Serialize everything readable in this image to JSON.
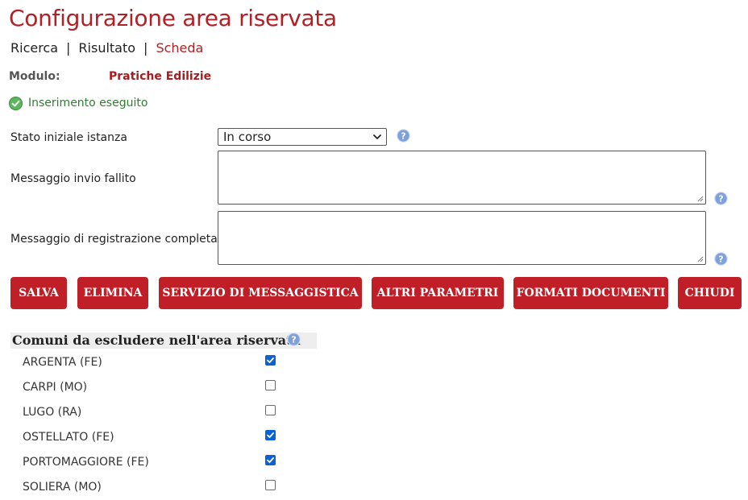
{
  "header": {
    "title": "Configurazione area riservata"
  },
  "breadcrumb": {
    "items": [
      "Ricerca",
      "Risultato",
      "Scheda"
    ],
    "separator": "|"
  },
  "module": {
    "label": "Modulo:",
    "value": "Pratiche Edilizie"
  },
  "status": {
    "message": "Inserimento eseguito",
    "icon": "check-circle-icon"
  },
  "form": {
    "stato_label": "Stato iniziale istanza",
    "stato_value": "In corso",
    "messaggio_fallito_label": "Messaggio invio fallito",
    "messaggio_fallito_value": "",
    "messaggio_registrazione_label": "Messaggio di registrazione completata",
    "messaggio_registrazione_value": ""
  },
  "buttons": [
    "SALVA",
    "ELIMINA",
    "SERVIZIO DI MESSAGGISTICA",
    "ALTRI PARAMETRI",
    "FORMATI DOCUMENTI",
    "CHIUDI"
  ],
  "comuni": {
    "title": "Comuni da escludere nell'area riservata",
    "items": [
      {
        "name": "ARGENTA (FE)",
        "checked": true
      },
      {
        "name": "CARPI (MO)",
        "checked": false
      },
      {
        "name": "LUGO (RA)",
        "checked": false
      },
      {
        "name": "OSTELLATO (FE)",
        "checked": true
      },
      {
        "name": "PORTOMAGGIORE (FE)",
        "checked": true
      },
      {
        "name": "SOLIERA (MO)",
        "checked": false
      }
    ]
  },
  "colors": {
    "accent": "#b21f24",
    "button": "#c01f27",
    "success": "#2e7d32",
    "checkbox": "#0b62d6",
    "help": "#6c8fc9"
  }
}
